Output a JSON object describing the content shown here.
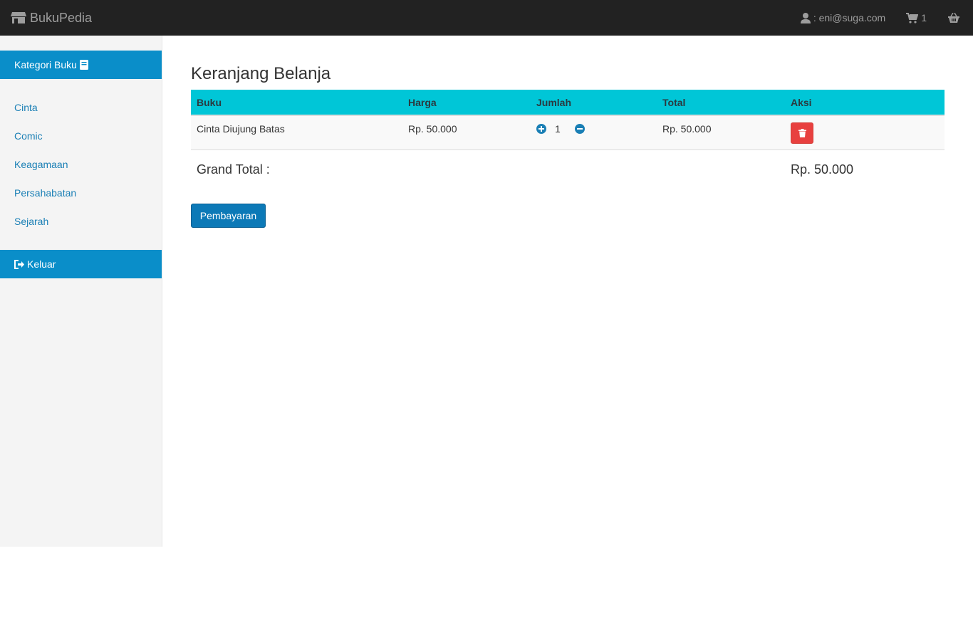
{
  "navbar": {
    "brand": "BukuPedia",
    "user_email": ": eni@suga.com",
    "cart_count": "1",
    "icons": [
      "store-icon",
      "user-icon",
      "cart-icon",
      "basket-icon"
    ]
  },
  "sidebar": {
    "category_header": "Kategori Buku",
    "categories": [
      "Cinta",
      "Comic",
      "Keagamaan",
      "Persahabatan",
      "Sejarah"
    ],
    "logout": "Keluar"
  },
  "main": {
    "title": "Keranjang Belanja",
    "columns": [
      "Buku",
      "Harga",
      "Jumlah",
      "Total",
      "Aksi"
    ],
    "rows": [
      {
        "buku": "Cinta Diujung Batas",
        "harga": "Rp. 50.000",
        "jumlah": "1",
        "total": "Rp. 50.000"
      }
    ],
    "grand_total_label": "Grand Total :",
    "grand_total_value": "Rp. 50.000",
    "pay_button": "Pembayaran"
  },
  "colors": {
    "navbar": "#222222",
    "sidebar_header": "#0a8ec9",
    "table_header": "#00c6d7",
    "delete": "#e8403f",
    "primary_button": "#0c79b7"
  }
}
